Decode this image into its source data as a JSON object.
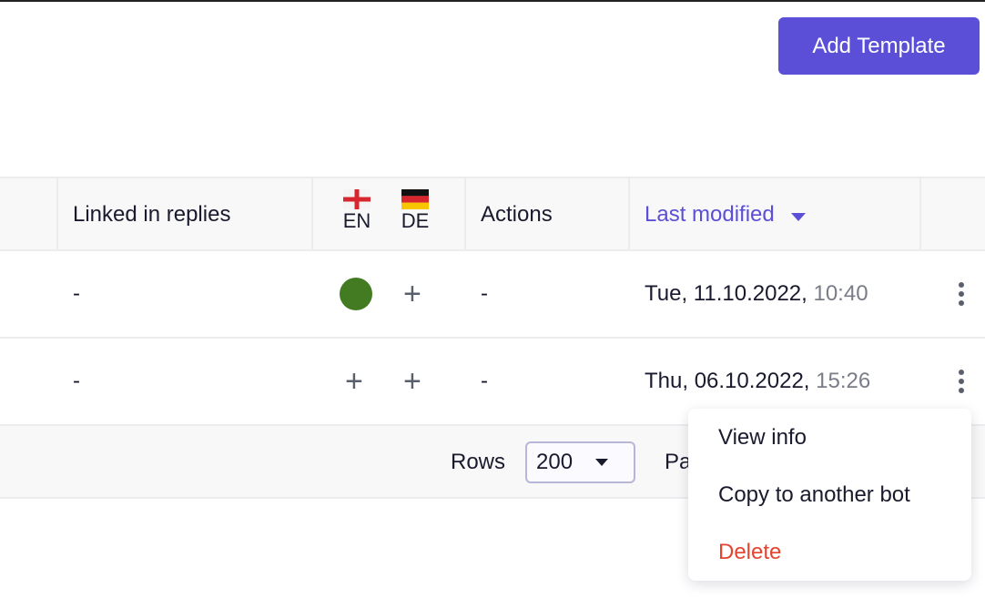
{
  "toolbar": {
    "add_template_label": "Add Template"
  },
  "table": {
    "headers": {
      "linked": "Linked in replies",
      "lang_en": "EN",
      "lang_de": "DE",
      "actions": "Actions",
      "last_modified": "Last modified"
    },
    "sort": {
      "column": "Last modified",
      "direction": "descending"
    },
    "accent_color": "#5a4fd6",
    "rows": [
      {
        "linked": "-",
        "en_status": "exists",
        "de_status": "add",
        "actions": "-",
        "date": "Tue, 11.10.2022,",
        "time": "10:40"
      },
      {
        "linked": "-",
        "en_status": "add",
        "de_status": "add",
        "actions": "-",
        "date": "Thu, 06.10.2022,",
        "time": "15:26"
      }
    ],
    "plus": "+"
  },
  "footer": {
    "rows_label": "Rows",
    "rows_value": "200",
    "page_label": "Pa"
  },
  "context_menu": {
    "items": [
      {
        "label": "View info"
      },
      {
        "label": "Copy to another bot"
      },
      {
        "label": "Delete",
        "color": "#e5432f"
      }
    ]
  }
}
